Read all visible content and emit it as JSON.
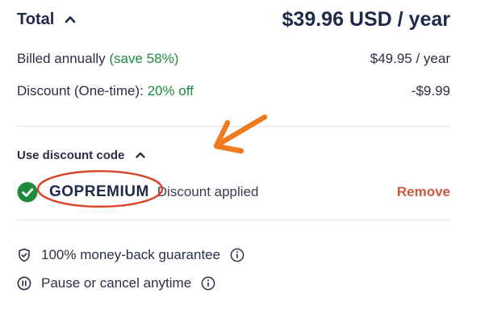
{
  "summary": {
    "total_label": "Total",
    "total_price": "$39.96 USD / year",
    "billed_label": "Billed annually",
    "billed_save": "(save 58%)",
    "billed_price": "$49.95 / year",
    "discount_label": "Discount (One-time):",
    "discount_amount_label": "20% off",
    "discount_value": "-$9.99"
  },
  "discount_code": {
    "toggle_label": "Use discount code",
    "code": "GOPREMIUM",
    "status": "Discount applied",
    "remove_label": "Remove"
  },
  "features": [
    {
      "label": "100% money-back guarantee",
      "icon": "shield-check-icon"
    },
    {
      "label": "Pause or cancel anytime",
      "icon": "pause-circle-icon"
    }
  ],
  "colors": {
    "text_dark": "#1f2a4a",
    "green": "#1e8a3c",
    "remove": "#d2553e",
    "annotation": "#d9452a",
    "arrow": "#f07a1f"
  }
}
